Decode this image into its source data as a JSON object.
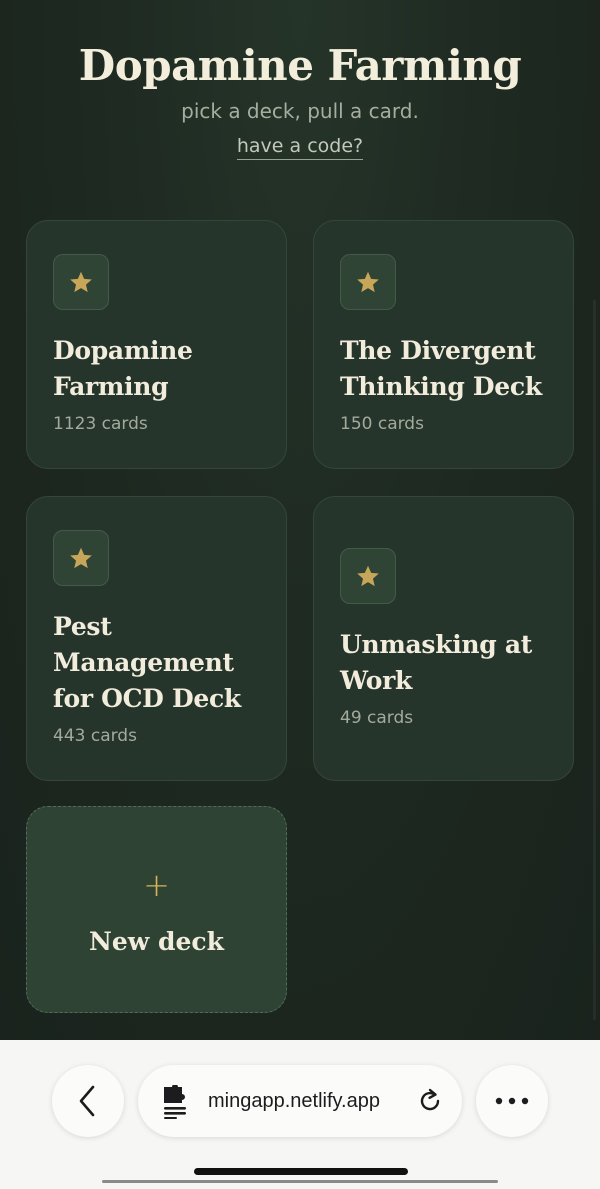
{
  "header": {
    "title": "Dopamine Farming",
    "subtitle": "pick a deck, pull a card.",
    "code_link": "have a code?"
  },
  "decks": [
    {
      "name": "Dopamine Farming",
      "count": "1123 cards",
      "icon": "star-icon"
    },
    {
      "name": "The Divergent Thinking Deck",
      "count": "150 cards",
      "icon": "star-icon"
    },
    {
      "name": "Pest Management for OCD Deck",
      "count": "443 cards",
      "icon": "star-icon"
    },
    {
      "name": "Unmasking at Work",
      "count": "49 cards",
      "icon": "star-icon"
    }
  ],
  "new_deck": {
    "plus": "+",
    "label": "New deck"
  },
  "browser": {
    "url": "mingapp.netlify.app",
    "back_icon": "chevron-left-icon",
    "page_icon": "puzzle-doc-icon",
    "reload_icon": "reload-icon",
    "more_icon": "ellipsis-icon"
  },
  "colors": {
    "background": "#1d2820",
    "card": "#26352b",
    "accent_gold": "#c7a65a",
    "text_cream": "#f1ecdb"
  }
}
